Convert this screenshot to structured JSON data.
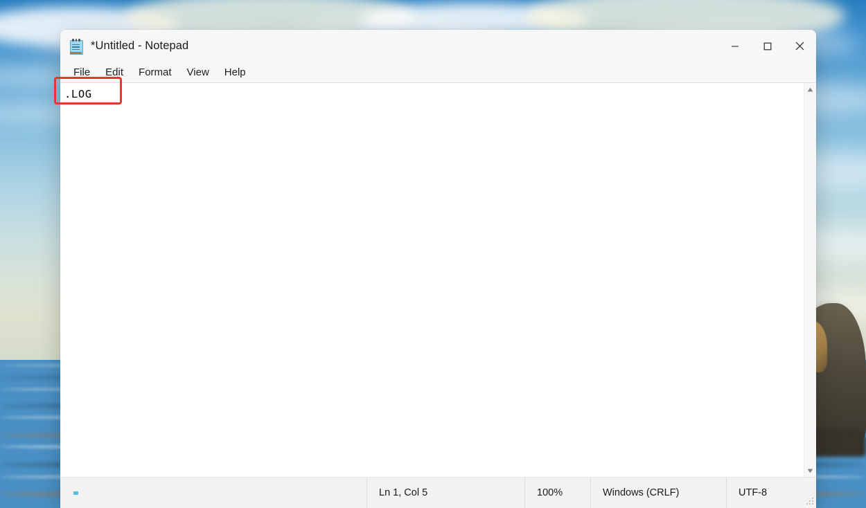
{
  "window": {
    "title": "*Untitled - Notepad",
    "icon": "notepad-icon",
    "controls": {
      "minimize": "minimize-icon",
      "maximize": "maximize-icon",
      "close": "close-icon"
    }
  },
  "menubar": {
    "items": [
      {
        "label": "File"
      },
      {
        "label": "Edit"
      },
      {
        "label": "Format"
      },
      {
        "label": "View"
      },
      {
        "label": "Help"
      }
    ]
  },
  "editor": {
    "content": ".LOG",
    "scrollbar": {
      "up_arrow": "chevron-up-icon",
      "down_arrow": "chevron-down-icon"
    }
  },
  "statusbar": {
    "line_col": "Ln 1, Col 5",
    "zoom": "100%",
    "line_ending": "Windows (CRLF)",
    "encoding": "UTF-8",
    "resize_grip": "resize-grip-icon"
  },
  "annotation": {
    "highlight_color": "#e03a2f",
    "target": ".LOG"
  },
  "desktop": {
    "wallpaper": "beach-coast-sky-wallpaper"
  }
}
